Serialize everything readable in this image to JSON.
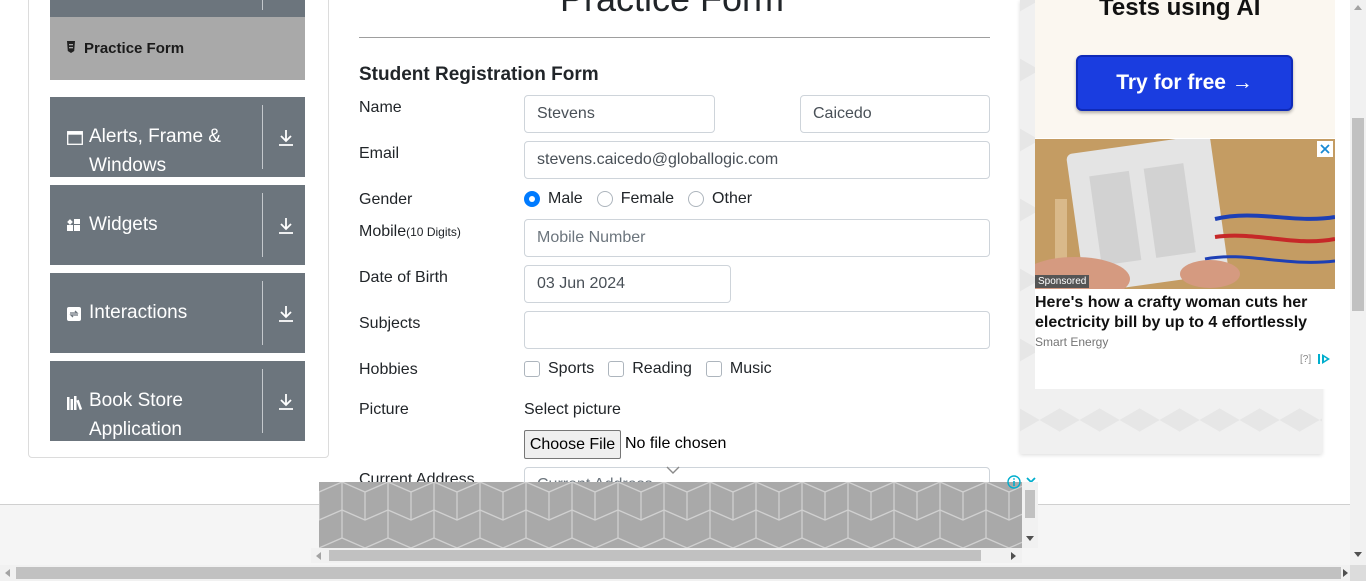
{
  "sidebar": {
    "active_item": "Practice Form",
    "groups": [
      {
        "label": "Alerts, Frame & Windows",
        "icon": "window-icon"
      },
      {
        "label": "Widgets",
        "icon": "widgets-icon"
      },
      {
        "label": "Interactions",
        "icon": "interactions-icon"
      },
      {
        "label": "Book Store Application",
        "icon": "books-icon"
      }
    ]
  },
  "form": {
    "page_title": "Practice Form",
    "heading": "Student Registration Form",
    "labels": {
      "name": "Name",
      "email": "Email",
      "gender": "Gender",
      "mobile": "Mobile",
      "mobile_hint": "(10 Digits)",
      "dob": "Date of Birth",
      "subjects": "Subjects",
      "hobbies": "Hobbies",
      "picture": "Picture",
      "current_address": "Current Address"
    },
    "first_name": "Stevens",
    "last_name": "Caicedo",
    "email": "stevens.caicedo@globallogic.com",
    "mobile_placeholder": "Mobile Number",
    "dob": "03 Jun 2024",
    "subjects": "",
    "gender_options": [
      "Male",
      "Female",
      "Other"
    ],
    "gender_selected": "Male",
    "hobbies": [
      "Sports",
      "Reading",
      "Music"
    ],
    "picture_label": "Select picture",
    "choose_file": "Choose File",
    "no_file": "No file chosen",
    "address_placeholder": "Current Address"
  },
  "ad_right": {
    "top_title": "Tests using AI",
    "cta": "Try for free →",
    "sponsored": "Sponsored",
    "headline": "Here's how a crafty woman cuts her electricity bill by up to 4 effortlessly",
    "source": "Smart Energy",
    "choices_q": "[?]"
  },
  "colors": {
    "sidebar_group": "#6c757d",
    "sidebar_active": "#a9a9a9",
    "accent": "#007bff",
    "ad_button": "#1a3de0"
  }
}
